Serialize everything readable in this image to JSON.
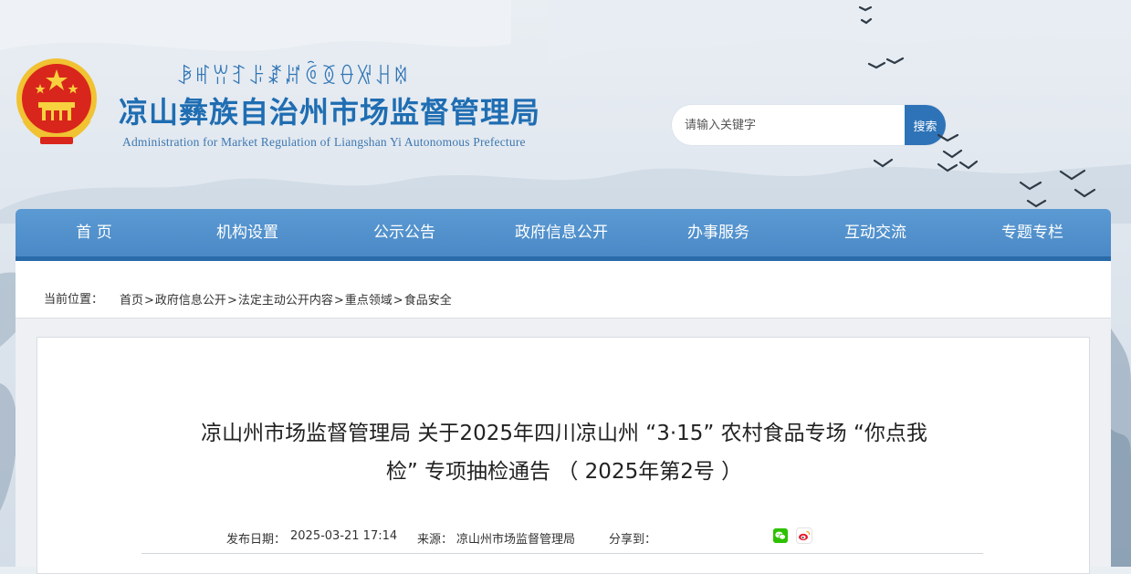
{
  "header": {
    "yi_script_title": "ꆃꎭꀕꆈꌠꊨꏦꏱꅉꂷꑟꃅꉈ",
    "site_title": "凉山彝族自治州市场监督管理局",
    "site_subtitle": "Administration for Market Regulation of Liangshan Yi Autonomous Prefecture",
    "logo_icon": "national-emblem-icon"
  },
  "search": {
    "placeholder": "请输入关键字",
    "button_label": "搜索"
  },
  "nav": {
    "items": [
      {
        "label": "首 页"
      },
      {
        "label": "机构设置"
      },
      {
        "label": "公示公告"
      },
      {
        "label": "政府信息公开"
      },
      {
        "label": "办事服务"
      },
      {
        "label": "互动交流"
      },
      {
        "label": "专题专栏"
      }
    ]
  },
  "breadcrumb": {
    "label": "当前位置：",
    "items": [
      "首页",
      "政府信息公开",
      "法定主动公开内容",
      "重点领域",
      "食品安全"
    ],
    "separator": ">"
  },
  "article": {
    "title_line1": "凉山州市场监督管理局 关于2025年四川凉山州 “3·15” 农村食品专场 “你点我",
    "title_line2": "检” 专项抽检通告 （ 2025年第2号 ）",
    "publish_label": "发布日期：",
    "publish_date": "2025-03-21 17:14",
    "source_label": "来源：",
    "source": "凉山州市场监督管理局",
    "share_label": "分享到：",
    "share_icons": [
      "wechat-icon",
      "weibo-icon"
    ]
  },
  "colors": {
    "brand_blue": "#1f6db2",
    "nav_blue": "#4a89c6",
    "search_button": "#2e73b8",
    "wechat_green": "#2dc100"
  }
}
